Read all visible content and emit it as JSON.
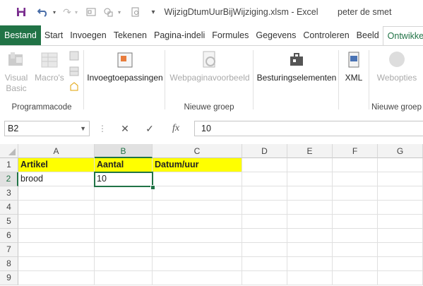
{
  "window": {
    "title": "WijzigDtumUurBijWijziging.xlsm - Excel",
    "user": "peter de smet"
  },
  "tabs": [
    {
      "label": "Bestand"
    },
    {
      "label": "Start"
    },
    {
      "label": "Invoegen"
    },
    {
      "label": "Tekenen"
    },
    {
      "label": "Pagina-indeli"
    },
    {
      "label": "Formules"
    },
    {
      "label": "Gegevens"
    },
    {
      "label": "Controleren"
    },
    {
      "label": "Beeld"
    },
    {
      "label": "Ontwikkelaar"
    }
  ],
  "ribbon": {
    "groups": [
      {
        "label": "Programmacode",
        "buttons": [
          "Visual Basic",
          "Macro's"
        ]
      },
      {
        "label": "",
        "buttons": [
          "Invoegtoepassingen"
        ]
      },
      {
        "label": "Nieuwe groep",
        "buttons": [
          "Webpaginavoorbeeld"
        ]
      },
      {
        "label": "",
        "buttons": [
          "Besturingselementen"
        ]
      },
      {
        "label": "",
        "buttons": [
          "XML"
        ]
      },
      {
        "label": "Nieuwe groep",
        "buttons": [
          "Webopties"
        ]
      }
    ],
    "visual_basic_line1": "Visual",
    "visual_basic_line2": "Basic"
  },
  "formula_bar": {
    "name_box": "B2",
    "fx": "fx",
    "value": "10"
  },
  "grid": {
    "columns": [
      "A",
      "B",
      "C",
      "D",
      "E",
      "F",
      "G"
    ],
    "rows": [
      "1",
      "2",
      "3",
      "4",
      "5",
      "6",
      "7",
      "8",
      "9"
    ],
    "selected_cell": "B2",
    "highlight_color": "#ffff00",
    "cells": {
      "A1": "Artikel",
      "B1": "Aantal",
      "C1": "Datum/uur",
      "A2": "brood",
      "B2": "10"
    }
  },
  "colors": {
    "accent": "#217346"
  }
}
